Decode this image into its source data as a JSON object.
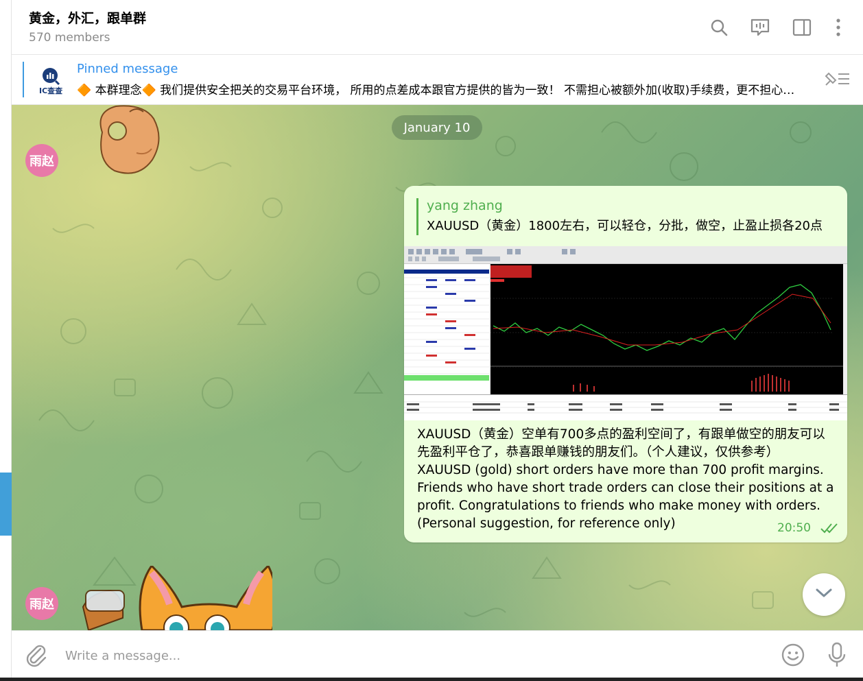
{
  "header": {
    "title": "黄金，外汇，跟单群",
    "members": "570 members"
  },
  "pinned": {
    "label": "Pinned message",
    "text": "🔶 本群理念🔶 我们提供安全把关的交易平台环境， 所用的点差成本跟官方提供的皆为一致！ 不需担心被额外加(收取)手续费，更不担心被平台",
    "thumb_text": "IC查查"
  },
  "chat": {
    "date_label": "January 10",
    "sender_initials": "雨赵"
  },
  "message": {
    "reply_name": "yang zhang",
    "reply_text": "XAUUSD（黄金）1800左右，可以轻仓，分批，做空，止盈止损各20点",
    "text_lines": [
      "XAUUSD（黄金）空单有700多点的盈利空间了，有跟单做空的朋友可以",
      "先盈利平仓了，恭喜跟单赚钱的朋友们。（个人建议，仅供参考）",
      "XAUUSD (gold) short orders have more than 700 profit margins.",
      "Friends who have short trade orders can close their positions at a",
      "profit. Congratulations to friends who make money with orders.",
      "(Personal suggestion, for reference only)"
    ],
    "time": "20:50"
  },
  "composer": {
    "placeholder": "Write a message..."
  },
  "icons": {
    "search": "search-icon",
    "video_chat": "voice-chat-icon",
    "sidebar": "sidebar-toggle-icon",
    "more": "more-vertical-icon",
    "unpin": "unpin-list-icon",
    "attach": "paperclip-icon",
    "emoji": "emoji-icon",
    "mic": "microphone-icon",
    "scroll_down": "chevron-down-icon"
  },
  "colors": {
    "accent": "#3390ec",
    "sender_green": "#4fae4e",
    "bubble": "#eeffde",
    "avatar": "#e879a8"
  }
}
